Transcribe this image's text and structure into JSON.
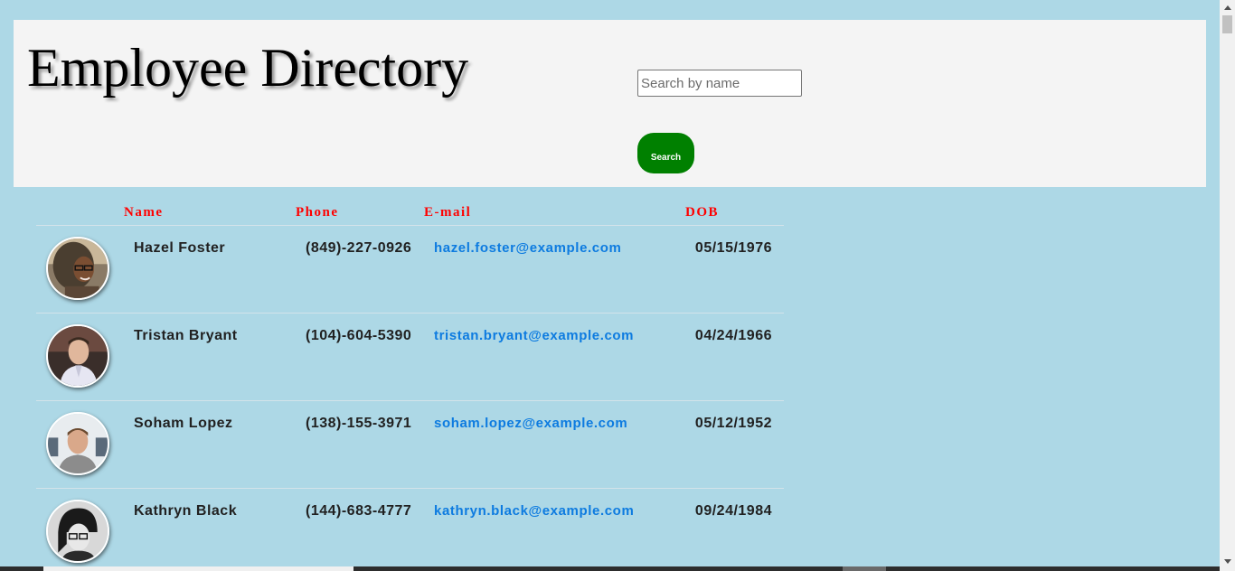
{
  "header": {
    "title": "Employee Directory",
    "search_placeholder": "Search by name",
    "search_button_label": "Search"
  },
  "table": {
    "columns": [
      "Name",
      "Phone",
      "E-mail",
      "DOB"
    ],
    "rows": [
      {
        "name": "Hazel Foster",
        "phone": "(849)-227-0926",
        "email": "hazel.foster@example.com",
        "dob": "05/15/1976"
      },
      {
        "name": "Tristan Bryant",
        "phone": "(104)-604-5390",
        "email": "tristan.bryant@example.com",
        "dob": "04/24/1966"
      },
      {
        "name": "Soham Lopez",
        "phone": "(138)-155-3971",
        "email": "soham.lopez@example.com",
        "dob": "05/12/1952"
      },
      {
        "name": "Kathryn Black",
        "phone": "(144)-683-4777",
        "email": "kathryn.black@example.com",
        "dob": "09/24/1984"
      }
    ]
  },
  "colors": {
    "page_background": "#add8e6",
    "header_background": "#f4f4f4",
    "column_header_text": "#ff0000",
    "search_button": "#008000",
    "email_link": "#0d7be0"
  }
}
